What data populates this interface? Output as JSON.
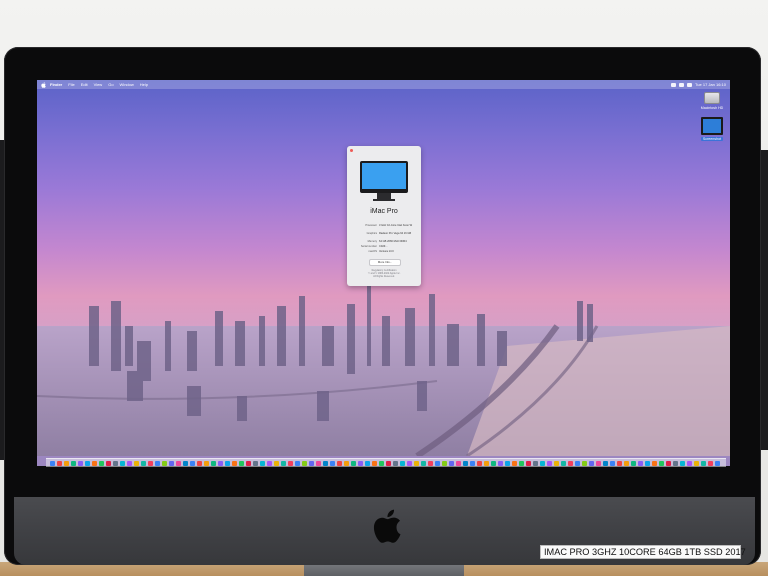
{
  "menubar": {
    "items": [
      "Finder",
      "File",
      "Edit",
      "View",
      "Go",
      "Window",
      "Help"
    ],
    "clock": "Tue 17 Jan  16:10"
  },
  "desktop": {
    "icons": [
      {
        "label": "Macintosh HD",
        "icon": "hard-drive-icon"
      },
      {
        "label": "Screenshot",
        "icon": "monitor-icon"
      }
    ]
  },
  "about_window": {
    "title": "iMac Pro",
    "specs": [
      {
        "key": "Processor",
        "value": "3 GHz 10-Core Intel Xeon W"
      },
      {
        "key": "Graphics",
        "value": "Radeon Pro Vega 64 16 GB"
      },
      {
        "key": "Memory",
        "value": "64 GB 2666 MHz DDR4"
      },
      {
        "key": "Serial number",
        "value": "C02Z..."
      },
      {
        "key": "macOS",
        "value": "Ventura 13.0"
      }
    ],
    "more_info_label": "More Info...",
    "footer_line1": "Regulatory Certification",
    "footer_line2": "™ and © 1983-2022 Apple Inc.",
    "footer_line3": "All Rights Reserved."
  },
  "dock": {
    "colors": [
      "#3b82f6",
      "#ef4444",
      "#f59e0b",
      "#10b981",
      "#8b5cf6",
      "#0ea5e9",
      "#f97316",
      "#22c55e",
      "#e11d48",
      "#64748b",
      "#06b6d4",
      "#a855f7",
      "#eab308",
      "#14b8a6",
      "#f43f5e",
      "#3b82f6",
      "#84cc16",
      "#6366f1",
      "#ec4899",
      "#0284c7"
    ]
  },
  "sticker": {
    "text": "IMAC PRO 3GHZ 10CORE 64GB 1TB SSD 2017"
  },
  "colors": {
    "bezel": "#0b0b0c",
    "chin": "#3e3f43",
    "wallpaper_top": "#5b63c8",
    "wallpaper_mid": "#e09ac0"
  }
}
